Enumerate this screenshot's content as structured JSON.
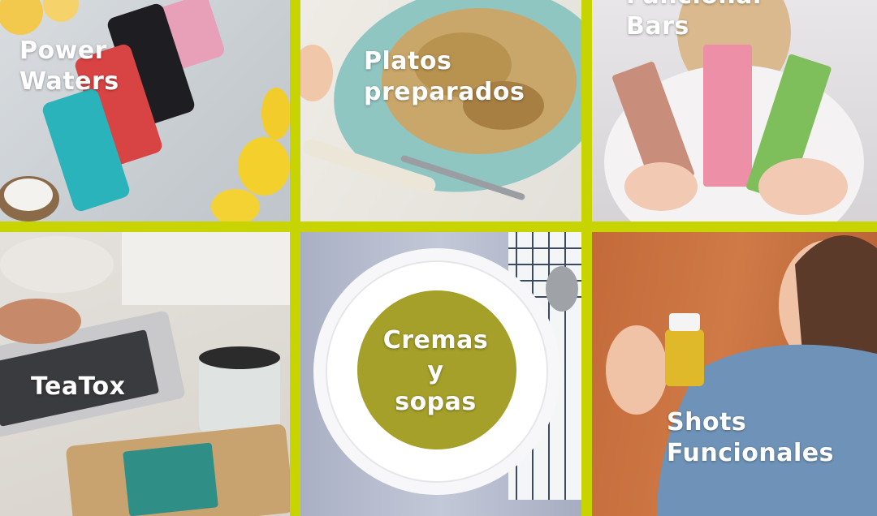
{
  "tiles": [
    {
      "lines": [
        "Power",
        "Waters"
      ]
    },
    {
      "lines": [
        "Platos",
        "preparados"
      ]
    },
    {
      "lines": [
        "Funcional",
        "Bars"
      ]
    },
    {
      "lines": [
        "TeaTox"
      ]
    },
    {
      "lines": [
        "Cremas",
        "y",
        "sopas"
      ]
    },
    {
      "lines": [
        "Shots",
        "Funcionales"
      ]
    }
  ],
  "colors": {
    "grid_accent": "#c7d400",
    "label_text": "#ffffff"
  }
}
